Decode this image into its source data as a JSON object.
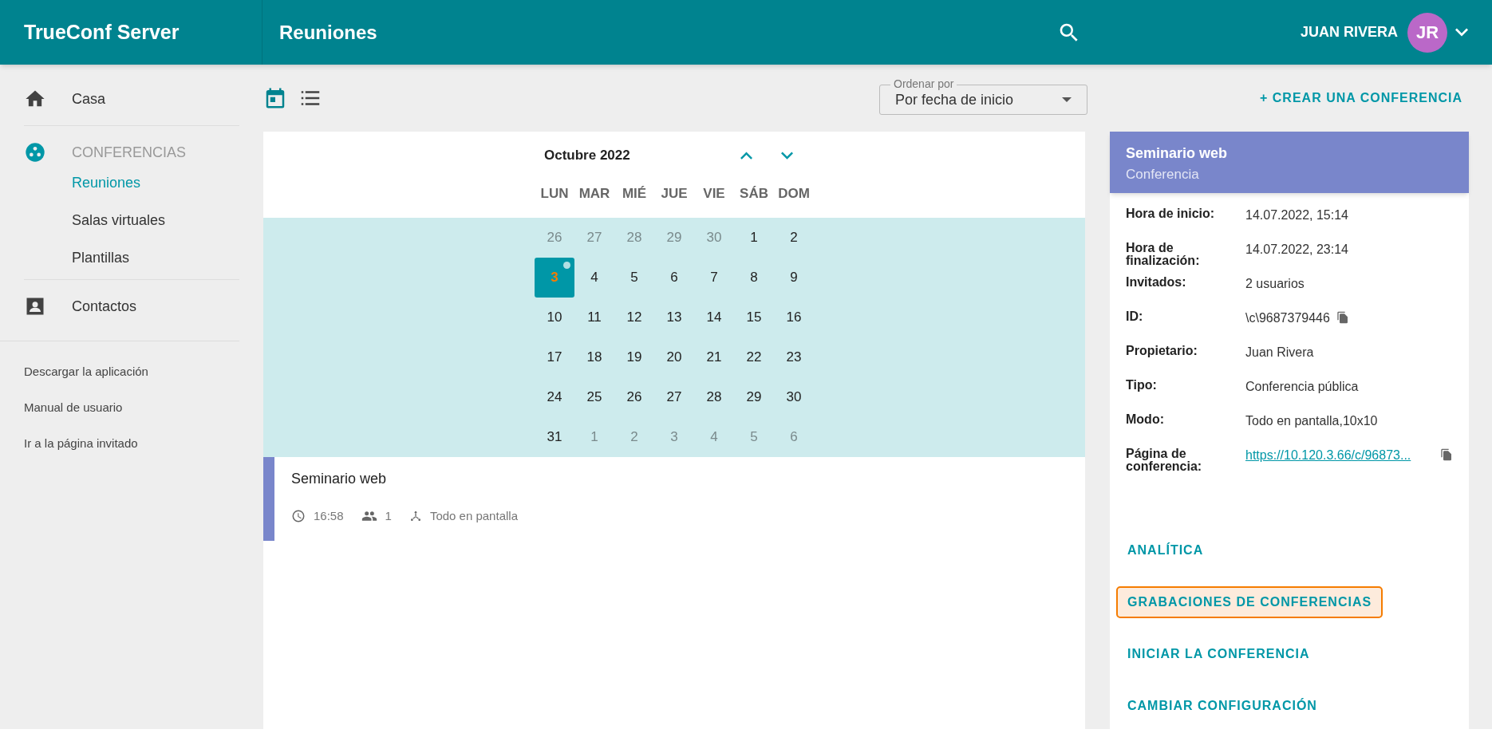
{
  "app_title": "TrueConf Server",
  "page_title": "Reuniones",
  "user": {
    "name": "JUAN RIVERA",
    "initials": "JR"
  },
  "sidebar": {
    "items": [
      {
        "kind": "home",
        "label": "Casa",
        "selected": false
      },
      {
        "kind": "group",
        "label": "CONFERENCIAS",
        "selected": false,
        "children": [
          {
            "label": "Reuniones",
            "selected": true
          },
          {
            "label": "Salas virtuales",
            "selected": false
          },
          {
            "label": "Plantillas",
            "selected": false
          }
        ]
      },
      {
        "kind": "contacts",
        "label": "Contactos",
        "selected": false
      }
    ],
    "links": [
      "Descargar la aplicación",
      "Manual de usuario",
      "Ir a la página invitado"
    ]
  },
  "views": [
    {
      "kind": "calendar",
      "selected": true
    },
    {
      "kind": "list",
      "selected": false
    }
  ],
  "sort": {
    "label": "Ordenar por",
    "value": "Por fecha de inicio"
  },
  "create_button": "+ CREAR UNA CONFERENCIA",
  "calendar": {
    "month": "Octubre 2022",
    "weekdays": [
      "LUN",
      "MAR",
      "MIÉ",
      "JUE",
      "VIE",
      "SÁB",
      "DOM"
    ],
    "weeks": [
      [
        {
          "day": "26",
          "muted": true,
          "selected": false,
          "event": false
        },
        {
          "day": "27",
          "muted": true,
          "selected": false,
          "event": false
        },
        {
          "day": "28",
          "muted": true,
          "selected": false,
          "event": false
        },
        {
          "day": "29",
          "muted": true,
          "selected": false,
          "event": false
        },
        {
          "day": "30",
          "muted": true,
          "selected": false,
          "event": false
        },
        {
          "day": "1",
          "muted": false,
          "selected": false,
          "event": false
        },
        {
          "day": "2",
          "muted": false,
          "selected": false,
          "event": false
        }
      ],
      [
        {
          "day": "3",
          "muted": false,
          "selected": true,
          "event": true
        },
        {
          "day": "4",
          "muted": false,
          "selected": false,
          "event": false
        },
        {
          "day": "5",
          "muted": false,
          "selected": false,
          "event": false
        },
        {
          "day": "6",
          "muted": false,
          "selected": false,
          "event": false
        },
        {
          "day": "7",
          "muted": false,
          "selected": false,
          "event": false
        },
        {
          "day": "8",
          "muted": false,
          "selected": false,
          "event": false
        },
        {
          "day": "9",
          "muted": false,
          "selected": false,
          "event": false
        }
      ],
      [
        {
          "day": "10",
          "muted": false,
          "selected": false,
          "event": false
        },
        {
          "day": "11",
          "muted": false,
          "selected": false,
          "event": false
        },
        {
          "day": "12",
          "muted": false,
          "selected": false,
          "event": false
        },
        {
          "day": "13",
          "muted": false,
          "selected": false,
          "event": false
        },
        {
          "day": "14",
          "muted": false,
          "selected": false,
          "event": false
        },
        {
          "day": "15",
          "muted": false,
          "selected": false,
          "event": false
        },
        {
          "day": "16",
          "muted": false,
          "selected": false,
          "event": false
        }
      ],
      [
        {
          "day": "17",
          "muted": false,
          "selected": false,
          "event": false
        },
        {
          "day": "18",
          "muted": false,
          "selected": false,
          "event": false
        },
        {
          "day": "19",
          "muted": false,
          "selected": false,
          "event": false
        },
        {
          "day": "20",
          "muted": false,
          "selected": false,
          "event": false
        },
        {
          "day": "21",
          "muted": false,
          "selected": false,
          "event": false
        },
        {
          "day": "22",
          "muted": false,
          "selected": false,
          "event": false
        },
        {
          "day": "23",
          "muted": false,
          "selected": false,
          "event": false
        }
      ],
      [
        {
          "day": "24",
          "muted": false,
          "selected": false,
          "event": false
        },
        {
          "day": "25",
          "muted": false,
          "selected": false,
          "event": false
        },
        {
          "day": "26",
          "muted": false,
          "selected": false,
          "event": false
        },
        {
          "day": "27",
          "muted": false,
          "selected": false,
          "event": false
        },
        {
          "day": "28",
          "muted": false,
          "selected": false,
          "event": false
        },
        {
          "day": "29",
          "muted": false,
          "selected": false,
          "event": false
        },
        {
          "day": "30",
          "muted": false,
          "selected": false,
          "event": false
        }
      ],
      [
        {
          "day": "31",
          "muted": false,
          "selected": false,
          "event": false
        },
        {
          "day": "1",
          "muted": true,
          "selected": false,
          "event": false
        },
        {
          "day": "2",
          "muted": true,
          "selected": false,
          "event": false
        },
        {
          "day": "3",
          "muted": true,
          "selected": false,
          "event": false
        },
        {
          "day": "4",
          "muted": true,
          "selected": false,
          "event": false
        },
        {
          "day": "5",
          "muted": true,
          "selected": false,
          "event": false
        },
        {
          "day": "6",
          "muted": true,
          "selected": false,
          "event": false
        }
      ]
    ]
  },
  "events": [
    {
      "title": "Seminario web",
      "time": "16:58",
      "participants": "1",
      "mode": "Todo en pantalla",
      "color": "#7986cb"
    }
  ],
  "details": {
    "title": "Seminario web",
    "subtitle": "Conferencia",
    "rows": [
      {
        "label": "Hora de inicio:",
        "value": "14.07.2022, 15:14",
        "kind": "text",
        "copy": false
      },
      {
        "label": "Hora de finalización:",
        "value": "14.07.2022, 23:14",
        "kind": "text",
        "copy": false
      },
      {
        "label": "Invitados:",
        "value": "2 usuarios",
        "kind": "text",
        "copy": false
      },
      {
        "label": "ID:",
        "value": "\\c\\9687379446",
        "kind": "text",
        "copy": true
      },
      {
        "label": "Propietario:",
        "value": "Juan Rivera",
        "kind": "text",
        "copy": false
      },
      {
        "label": "Tipo:",
        "value": "Conferencia pública",
        "kind": "text",
        "copy": false
      },
      {
        "label": "Modo:",
        "value": "Todo en pantalla,10x10",
        "kind": "text",
        "copy": false
      },
      {
        "label": "Página de conferencia:",
        "value": "https://10.120.3.66/c/96873...",
        "kind": "link",
        "copy": true
      }
    ],
    "actions": [
      {
        "label": "ANALÍTICA",
        "highlighted": false
      },
      {
        "label": "GRABACIONES DE CONFERENCIAS",
        "highlighted": true
      },
      {
        "label": "INICIAR LA CONFERENCIA",
        "highlighted": false
      },
      {
        "label": "CAMBIAR CONFIGURACIÓN",
        "highlighted": false
      }
    ]
  }
}
